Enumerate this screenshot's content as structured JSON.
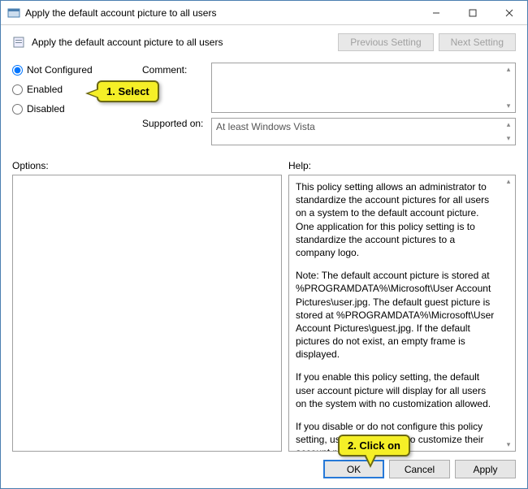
{
  "window": {
    "title": "Apply the default account picture to all users"
  },
  "header": {
    "title": "Apply the default account picture to all users",
    "prev_button": "Previous Setting",
    "next_button": "Next Setting"
  },
  "radios": {
    "not_configured": "Not Configured",
    "enabled": "Enabled",
    "disabled": "Disabled",
    "selected": "not_configured"
  },
  "labels": {
    "comment": "Comment:",
    "supported": "Supported on:",
    "options": "Options:",
    "help": "Help:"
  },
  "fields": {
    "comment_value": "",
    "supported_value": "At least Windows Vista"
  },
  "help": {
    "p1": "This policy setting allows an administrator to standardize the account pictures for all users on a system to the default account picture. One application for this policy setting is to standardize the account pictures to a company logo.",
    "p2": "Note: The default account picture is stored at %PROGRAMDATA%\\Microsoft\\User Account Pictures\\user.jpg. The default guest picture is stored at %PROGRAMDATA%\\Microsoft\\User Account Pictures\\guest.jpg. If the default pictures do not exist, an empty frame is displayed.",
    "p3": "If you enable this policy setting, the default user account picture will display for all users on the system with no customization allowed.",
    "p4": "If you disable or do not configure this policy setting, users will be able to customize their account pictures."
  },
  "footer": {
    "ok": "OK",
    "cancel": "Cancel",
    "apply": "Apply"
  },
  "callouts": {
    "select": "1.  Select",
    "click": "2.  Click on"
  }
}
